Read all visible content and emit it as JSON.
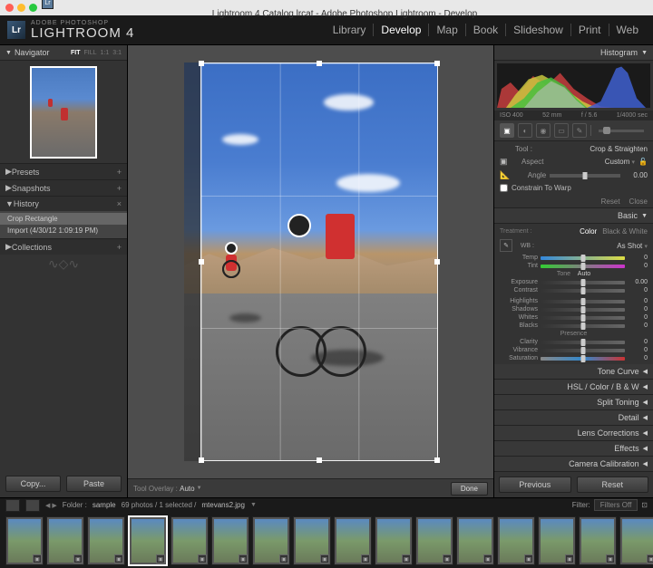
{
  "titlebar": {
    "title": "Lightroom 4 Catalog.lrcat - Adobe Photoshop Lightroom - Develop"
  },
  "brand": {
    "small": "ADOBE PHOTOSHOP",
    "big": "LIGHTROOM 4",
    "logo": "Lr"
  },
  "modules": [
    "Library",
    "Develop",
    "Map",
    "Book",
    "Slideshow",
    "Print",
    "Web"
  ],
  "activeModule": "Develop",
  "left": {
    "navigator": {
      "label": "Navigator",
      "fit": "FIT",
      "fill": "FILL",
      "z1": "1:1",
      "z2": "3:1"
    },
    "presets": "Presets",
    "snapshots": "Snapshots",
    "history": {
      "label": "History",
      "items": [
        "Crop Rectangle",
        "Import (4/30/12 1:09:19 PM)"
      ]
    },
    "collections": "Collections",
    "copy": "Copy...",
    "paste": "Paste"
  },
  "center": {
    "toolOverlay": "Tool Overlay :",
    "toolMode": "Auto",
    "done": "Done"
  },
  "right": {
    "histogram": {
      "label": "Histogram",
      "iso": "ISO 400",
      "focal": "52 mm",
      "aperture": "f / 5.6",
      "shutter": "1/4000 sec"
    },
    "tool": {
      "label": "Tool :",
      "name": "Crop & Straighten",
      "aspect": "Aspect",
      "aspectVal": "Custom",
      "angle": "Angle",
      "angleVal": "0.00",
      "constrain": "Constrain To Warp",
      "reset": "Reset",
      "close": "Close"
    },
    "basic": {
      "label": "Basic",
      "treatment": "Treatment :",
      "color": "Color",
      "bw": "Black & White",
      "wb": "WB :",
      "wbVal": "As Shot",
      "temp": "Temp",
      "tint": "Tint",
      "tone": "Tone",
      "auto": "Auto",
      "exposure": "Exposure",
      "exposureVal": "0.00",
      "contrast": "Contrast",
      "highlights": "Highlights",
      "shadows": "Shadows",
      "whites": "Whites",
      "blacks": "Blacks",
      "presence": "Presence",
      "clarity": "Clarity",
      "vibrance": "Vibrance",
      "saturation": "Saturation",
      "zero": "0"
    },
    "panels": [
      "Tone Curve",
      "HSL / Color / B & W",
      "Split Toning",
      "Detail",
      "Lens Corrections",
      "Effects",
      "Camera Calibration"
    ],
    "previous": "Previous",
    "reset": "Reset"
  },
  "filmstrip": {
    "folder": "Folder :",
    "folderName": "sample",
    "count": "69 photos / 1 selected /",
    "file": "mtevans2.jpg",
    "filter": "Filter:",
    "filterVal": "Filters Off"
  }
}
